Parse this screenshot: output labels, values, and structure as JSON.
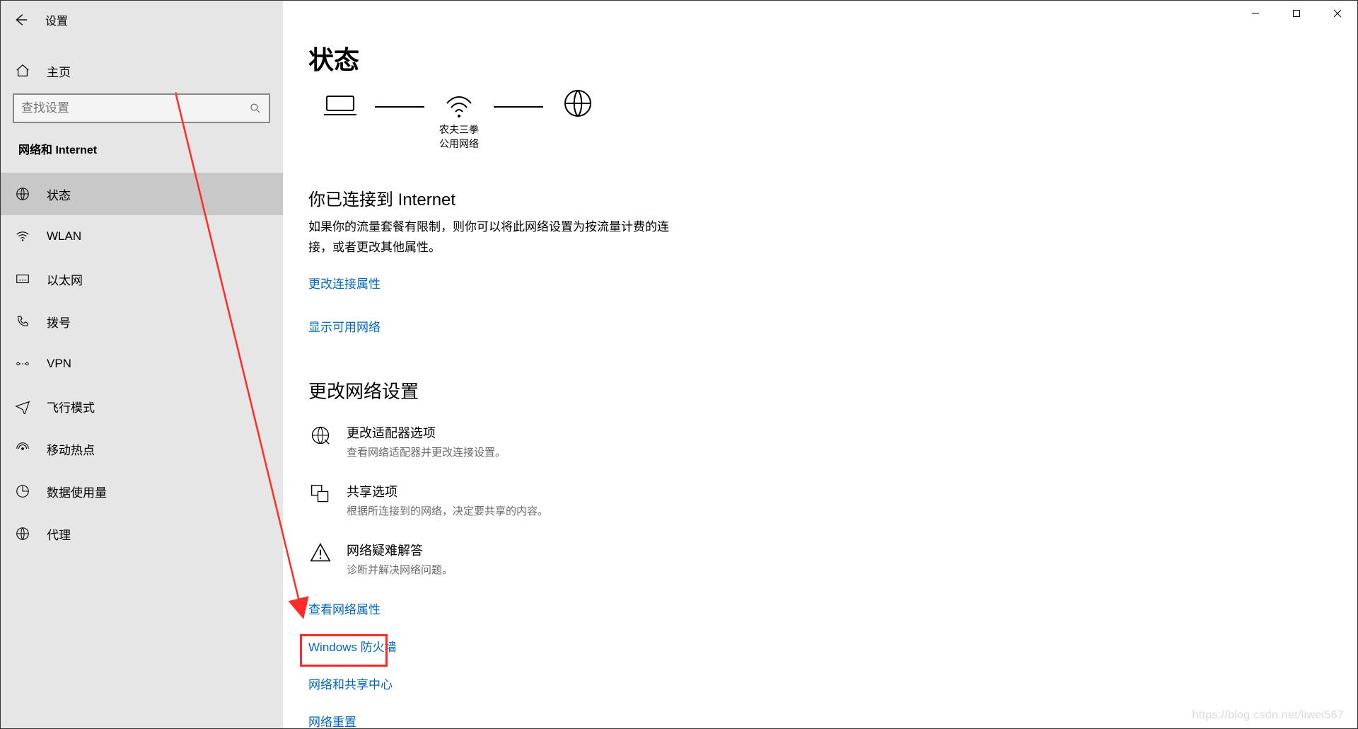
{
  "window": {
    "title": "设置"
  },
  "sidebar": {
    "home_label": "主页",
    "search_placeholder": "查找设置",
    "category_label": "网络和 Internet",
    "items": [
      {
        "icon": "status",
        "label": "状态",
        "selected": true
      },
      {
        "icon": "wifi",
        "label": "WLAN"
      },
      {
        "icon": "ethernet",
        "label": "以太网"
      },
      {
        "icon": "dialup",
        "label": "拨号"
      },
      {
        "icon": "vpn",
        "label": "VPN"
      },
      {
        "icon": "airplane",
        "label": "飞行模式"
      },
      {
        "icon": "hotspot",
        "label": "移动热点"
      },
      {
        "icon": "data",
        "label": "数据使用量"
      },
      {
        "icon": "proxy",
        "label": "代理"
      }
    ]
  },
  "main": {
    "page_title": "状态",
    "diagram": {
      "wifi_name": "农夫三拳",
      "wifi_type": "公用网络"
    },
    "connected": {
      "heading": "你已连接到 Internet",
      "body": "如果你的流量套餐有限制，则你可以将此网络设置为按流量计费的连接，或者更改其他属性。"
    },
    "links": {
      "change_props": "更改连接属性",
      "show_networks": "显示可用网络"
    },
    "change_section_title": "更改网络设置",
    "options": [
      {
        "title": "更改适配器选项",
        "desc": "查看网络适配器并更改连接设置。"
      },
      {
        "title": "共享选项",
        "desc": "根据所连接到的网络，决定要共享的内容。"
      },
      {
        "title": "网络疑难解答",
        "desc": "诊断并解决网络问题。"
      }
    ],
    "plain_links": [
      "查看网络属性",
      "Windows 防火墙",
      "网络和共享中心",
      "网络重置"
    ]
  },
  "watermark": "https://blog.csdn.net/liwei567"
}
